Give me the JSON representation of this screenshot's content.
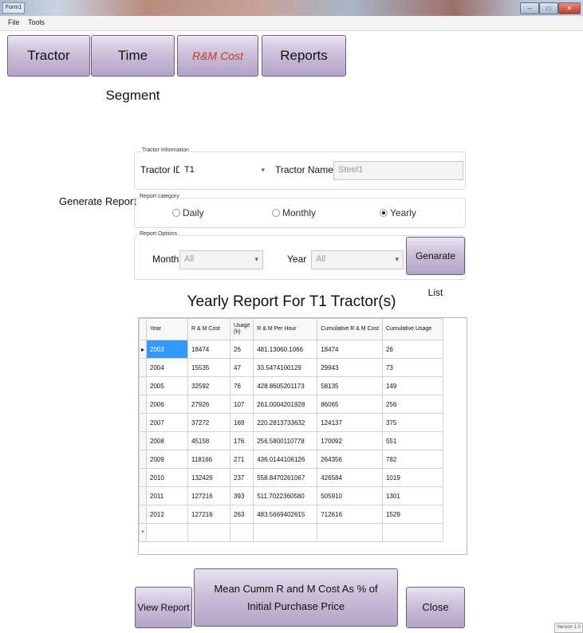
{
  "window": {
    "title": "Form1",
    "controls": [
      "–",
      "□",
      "✕"
    ]
  },
  "menu": {
    "items": [
      "File",
      "Tools"
    ]
  },
  "tabs": [
    {
      "label": "Tractor"
    },
    {
      "label": "Time Segment"
    },
    {
      "label": "R&M Cost",
      "active": true
    },
    {
      "label": "Reports"
    }
  ],
  "generate_report_label": "Generate Report",
  "tractor_info": {
    "legend": "Tractor Information",
    "tractor_id_label": "Tractor ID",
    "tractor_id_value": "T1",
    "tractor_name_label": "Tractor Name",
    "tractor_name_value": "Steel1"
  },
  "report_category": {
    "legend": "Report category",
    "options": [
      "Daily",
      "Monthly",
      "Yearly"
    ],
    "selected": "Yearly"
  },
  "report_options": {
    "legend": "Report Options",
    "month_label": "Month",
    "month_value": "All",
    "year_label": "Year",
    "year_value": "All",
    "generate_list_label": "Genarate List"
  },
  "report_title": "Yearly Report For T1 Tractor(s)",
  "table": {
    "columns": [
      "Year",
      "R & M Cost",
      "Usage (h)",
      "R & M Per Hour",
      "Cumulative R & M Cost",
      "Cumulative Usage"
    ],
    "rows": [
      [
        "2003",
        "18474",
        "26",
        "481.13060.1066",
        "18474",
        "26"
      ],
      [
        "2004",
        "15535",
        "47",
        "33.5474100129",
        "29943",
        "73"
      ],
      [
        "2005",
        "32592",
        "76",
        "428.8605201173",
        "58135",
        "149"
      ],
      [
        "2006",
        "27926",
        "107",
        "261.0004201928",
        "86065",
        "256"
      ],
      [
        "2007",
        "37272",
        "169",
        "220.2813733632",
        "124137",
        "375"
      ],
      [
        "2008",
        "45158",
        "176",
        "256.5800110778",
        "170092",
        "551"
      ],
      [
        "2009",
        "118166",
        "271",
        "436.0144106126",
        "264356",
        "782"
      ],
      [
        "2010",
        "132426",
        "237",
        "558.8470261067",
        "426584",
        "1019"
      ],
      [
        "2011",
        "127216",
        "393",
        "511.7022360580",
        "505910",
        "1301"
      ],
      [
        "2012",
        "127216",
        "263",
        "483.5669402615",
        "712616",
        "1529"
      ]
    ],
    "current_row_marker": "▸",
    "new_row_marker": "*"
  },
  "buttons": {
    "view_report": "View Report",
    "mean_cumm": "Mean Cumm R and M Cost As % of Initial Purchase Price",
    "close": "Close"
  },
  "status_tag": "Version 1.0"
}
